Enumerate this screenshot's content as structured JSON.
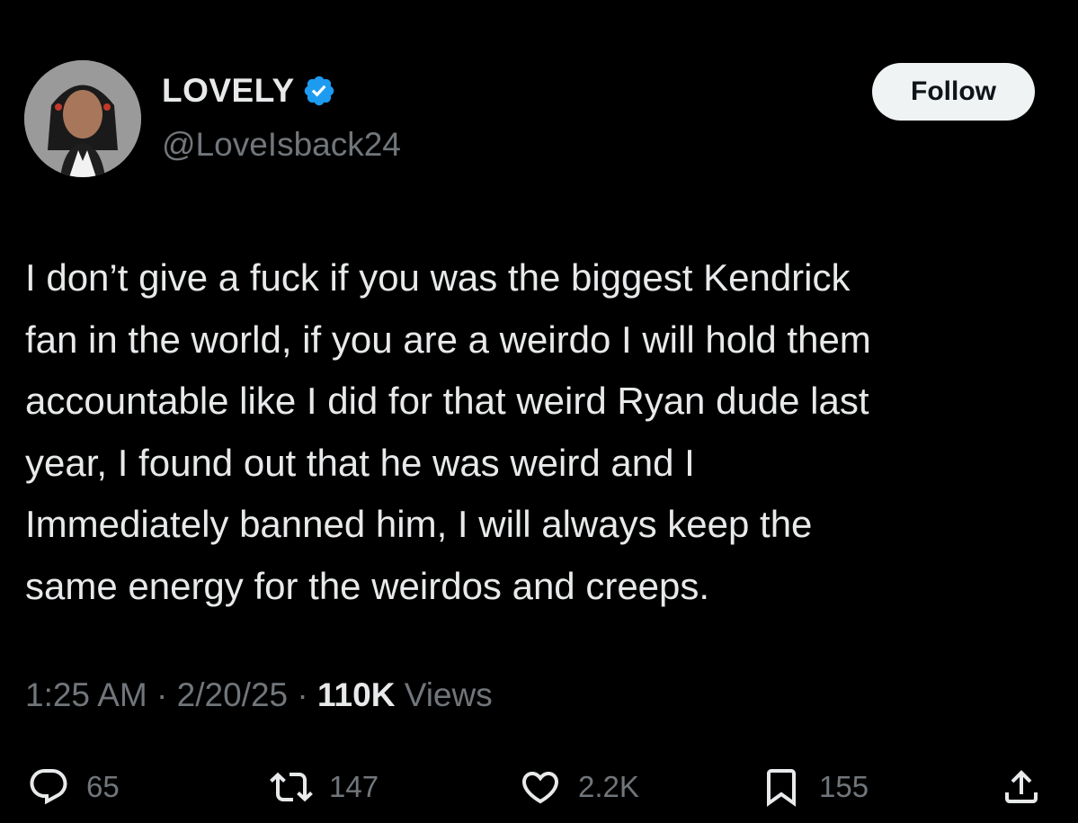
{
  "author": {
    "display_name": "LOVELY",
    "handle": "@LoveIsback24",
    "verified": true,
    "verified_color": "#1d9bf0"
  },
  "follow_button": {
    "label": "Follow"
  },
  "tweet": {
    "text": "I don’t give a fuck if you was the biggest Kendrick\nfan in the world, if you are a weirdo I will hold them\naccountable like I did for that weird Ryan dude last\nyear, I found out that he was weird and I\nImmediately banned him, I will always keep the\nsame energy for the weirdos and creeps.",
    "time": "1:25 AM",
    "separator": " · ",
    "date": "2/20/25",
    "views_count": "110K",
    "views_label": " Views"
  },
  "actions": {
    "replies": {
      "icon": "reply-icon",
      "count": "65"
    },
    "retweets": {
      "icon": "retweet-icon",
      "count": "147"
    },
    "likes": {
      "icon": "heart-icon",
      "count": "2.2K"
    },
    "bookmarks": {
      "icon": "bookmark-icon",
      "count": "155"
    },
    "share": {
      "icon": "share-icon"
    }
  },
  "colors": {
    "background": "#000000",
    "text_primary": "#e7e9ea",
    "text_secondary": "#71767b",
    "follow_bg": "#eff3f4"
  }
}
